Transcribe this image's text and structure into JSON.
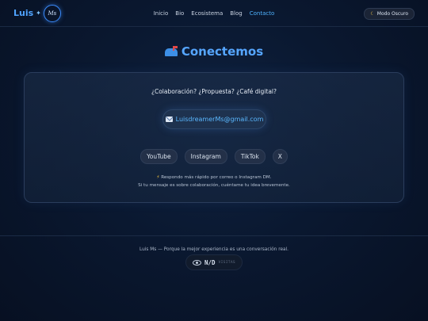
{
  "header": {
    "logo_text": "Luis",
    "logo_badge": "Ms",
    "nav": [
      {
        "label": "Inicio",
        "active": false
      },
      {
        "label": "Bio",
        "active": false
      },
      {
        "label": "Ecosistema",
        "active": false
      },
      {
        "label": "Blog",
        "active": false
      },
      {
        "label": "Contacto",
        "active": true
      }
    ],
    "mode_button_label": "Modo Oscuro",
    "mode_icon": "moon-icon"
  },
  "main": {
    "heading": "Conectemos",
    "heading_icon": "mailbox-icon",
    "tagline": "¿Colaboración? ¿Propuesta? ¿Café digital?",
    "email": "LuisdreamerMs@gmail.com",
    "email_icon": "envelope-icon",
    "socials": [
      "YouTube",
      "Instagram",
      "TikTok",
      "X"
    ],
    "note_line1": "Respondo más rápido por correo o Instagram DM.",
    "note_line2": "Si tu mensaje es sobre colaboración, cuéntame tu idea brevemente.",
    "note_icon": "lightning-icon"
  },
  "footer": {
    "text": "Luis Ms — Porque la mejor experiencia es una conversación real.",
    "views_count": "N/D",
    "views_label": "VISITAS"
  },
  "colors": {
    "accent": "#4fa3ff",
    "background": "#0a1830",
    "card_border": "#2a3d5c"
  }
}
